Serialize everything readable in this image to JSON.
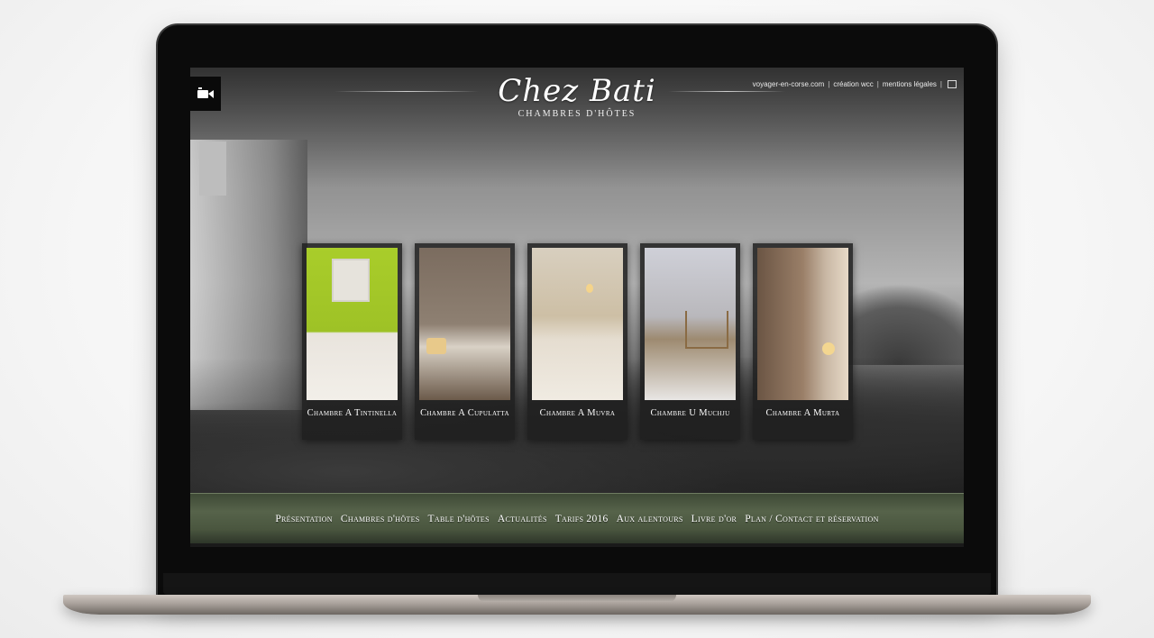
{
  "site": {
    "logo_title": "Chez Bati",
    "logo_subtitle": "CHAMBRES D'HÔTES"
  },
  "top_links": [
    {
      "label": "voyager-en-corse.com"
    },
    {
      "label": "création wcc"
    },
    {
      "label": "mentions légales"
    }
  ],
  "icons": {
    "video": "video-camera-icon",
    "external": "external-window-icon"
  },
  "rooms": [
    {
      "name": "Chambre A Tintinella"
    },
    {
      "name": "Chambre A Cupulatta"
    },
    {
      "name": "Chambre A Muvra"
    },
    {
      "name": "Chambre U Muchju"
    },
    {
      "name": "Chambre A Murta"
    }
  ],
  "menu": [
    {
      "label": "Présentation"
    },
    {
      "label": "Chambres d'hôtes"
    },
    {
      "label": "Table d'hôtes"
    },
    {
      "label": "Actualités"
    },
    {
      "label": "Tarifs 2016"
    },
    {
      "label": "Aux alentours"
    },
    {
      "label": "Livre d'or"
    },
    {
      "label": "Plan / Contact et réservation"
    }
  ],
  "colors": {
    "menu_bar": "#4a563f",
    "card_bg": "#1e1e1e",
    "text": "#ffffff"
  }
}
